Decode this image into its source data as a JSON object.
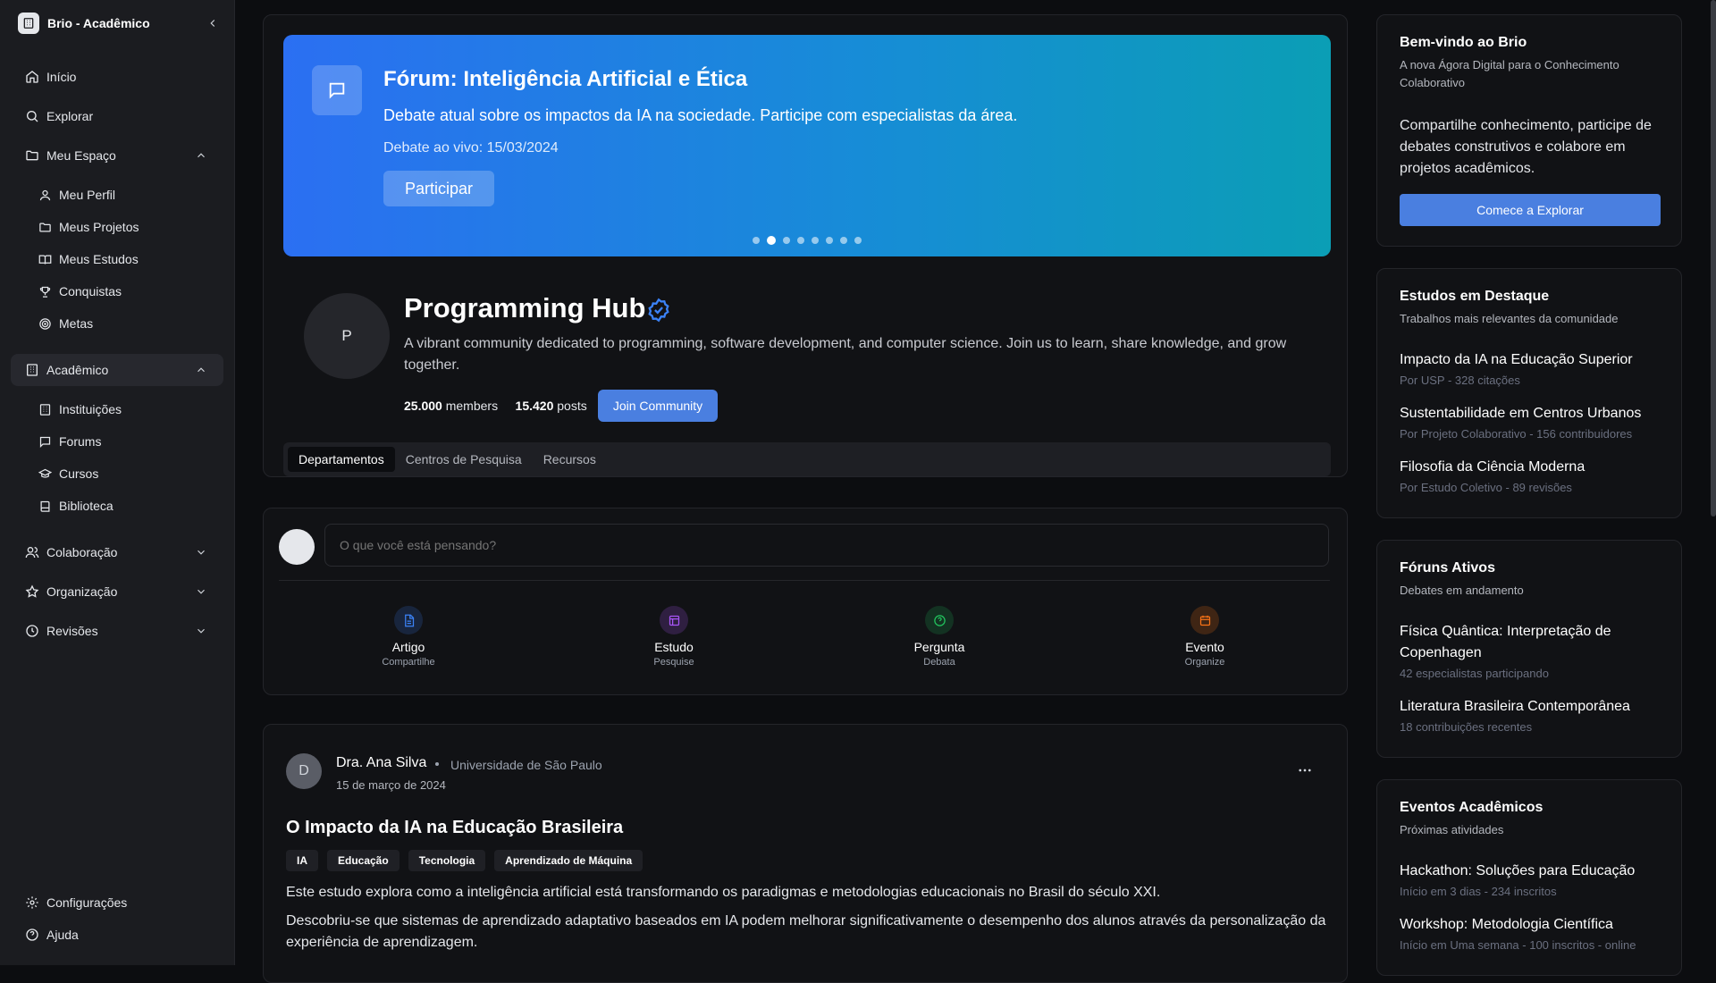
{
  "sidebar": {
    "brand": "Brio - Acadêmico",
    "nav": [
      {
        "label": "Início",
        "icon": "home-icon"
      },
      {
        "label": "Explorar",
        "icon": "search-icon"
      },
      {
        "label": "Meu Espaço",
        "icon": "folder-icon"
      }
    ],
    "meu_espaco": [
      "Meu Perfil",
      "Meus Projetos",
      "Meus Estudos",
      "Conquistas",
      "Metas"
    ],
    "academico": {
      "label": "Acadêmico",
      "items": [
        "Instituições",
        "Forums",
        "Cursos",
        "Biblioteca"
      ]
    },
    "groups": [
      "Colaboração",
      "Organização",
      "Revisões"
    ],
    "footer": [
      "Configurações",
      "Ajuda"
    ]
  },
  "hero": {
    "title": "Fórum: Inteligência Artificial e Ética",
    "description": "Debate atual sobre os impactos da IA na sociedade. Participe com especialistas da área.",
    "date": "Debate ao vivo: 15/03/2024",
    "button": "Participar",
    "slide_count": 8,
    "active_slide": 2
  },
  "community": {
    "initial": "P",
    "name": "Programming Hub",
    "description": "A vibrant community dedicated to programming, software development, and computer science. Join us to learn, share knowledge, and grow together.",
    "members_value": "25.000",
    "members_label": "members",
    "posts_value": "15.420",
    "posts_label": "posts",
    "join_label": "Join Community",
    "tabs": [
      "Departamentos",
      "Centros de Pesquisa",
      "Recursos"
    ]
  },
  "composer": {
    "placeholder": "O que você está pensando?",
    "actions": [
      {
        "label": "Artigo",
        "sub": "Compartilhe",
        "icon": "document-icon",
        "color": "#3b82f6"
      },
      {
        "label": "Estudo",
        "sub": "Pesquise",
        "icon": "layout-icon",
        "color": "#a855f7"
      },
      {
        "label": "Pergunta",
        "sub": "Debata",
        "icon": "help-circle-icon",
        "color": "#22c55e"
      },
      {
        "label": "Evento",
        "sub": "Organize",
        "icon": "calendar-icon",
        "color": "#f97316"
      }
    ]
  },
  "post": {
    "avatar_initial": "D",
    "author": "Dra. Ana Silva",
    "institution": "Universidade de São Paulo",
    "date": "15 de março de 2024",
    "title": "O Impacto da IA na Educação Brasileira",
    "tags": [
      "IA",
      "Educação",
      "Tecnologia",
      "Aprendizado de Máquina"
    ],
    "paragraph1": "Este estudo explora como a inteligência artificial está transformando os paradigmas e metodologias educacionais no Brasil do século XXI.",
    "paragraph2": "Descobriu-se que sistemas de aprendizado adaptativo baseados em IA podem melhorar significativamente o desempenho dos alunos através da personalização da experiência de aprendizagem."
  },
  "welcome": {
    "title": "Bem-vindo ao Brio",
    "subtitle": "A nova Ágora Digital para o Conhecimento Colaborativo",
    "body": "Compartilhe conhecimento, participe de debates construtivos e colabore em projetos acadêmicos.",
    "button": "Comece a Explorar"
  },
  "estudos": {
    "title": "Estudos em Destaque",
    "subtitle": "Trabalhos mais relevantes da comunidade",
    "items": [
      {
        "title": "Impacto da IA na Educação Superior",
        "meta": "Por USP - 328 citações"
      },
      {
        "title": "Sustentabilidade em Centros Urbanos",
        "meta": "Por Projeto Colaborativo - 156 contribuidores"
      },
      {
        "title": "Filosofia da Ciência Moderna",
        "meta": "Por Estudo Coletivo - 89 revisões"
      }
    ]
  },
  "foruns": {
    "title": "Fóruns Ativos",
    "subtitle": "Debates em andamento",
    "items": [
      {
        "title": "Física Quântica: Interpretação de Copenhagen",
        "meta": "42 especialistas participando"
      },
      {
        "title": "Literatura Brasileira Contemporânea",
        "meta": "18 contribuições recentes"
      }
    ]
  },
  "eventos": {
    "title": "Eventos Acadêmicos",
    "subtitle": "Próximas atividades",
    "items": [
      {
        "title": "Hackathon: Soluções para Educação",
        "meta": "Início em 3 dias - 234 inscritos"
      },
      {
        "title": "Workshop: Metodologia Científica",
        "meta": "Início em Uma semana - 100 inscritos - online"
      }
    ]
  }
}
